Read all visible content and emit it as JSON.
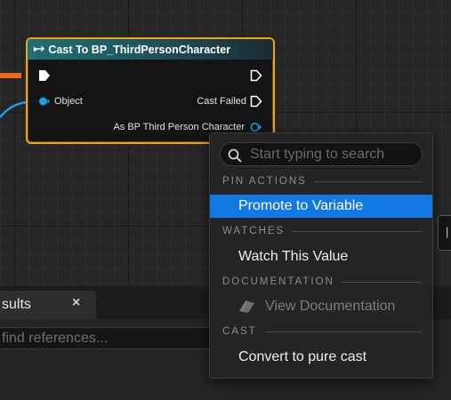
{
  "node": {
    "title": "Cast To BP_ThirdPersonCharacter",
    "header_icon": "cast-arrows-icon",
    "pins": {
      "object": "Object",
      "cast_failed": "Cast Failed",
      "as_character": "As BP Third Person Character"
    },
    "colors": {
      "border": "#f0a21f",
      "object_pin": "#1aa0e8",
      "exec_wire": "#f06a1c"
    }
  },
  "context_menu": {
    "search_placeholder": "Start typing to search",
    "sections": {
      "pin_actions": "PIN ACTIONS",
      "watches": "WATCHES",
      "documentation": "DOCUMENTATION",
      "cast": "CAST"
    },
    "items": {
      "promote": "Promote to Variable",
      "watch": "Watch This Value",
      "view_docs": "View Documentation",
      "convert": "Convert to pure cast"
    },
    "selected": "Promote to Variable",
    "highlight_color": "#1178e4"
  },
  "results_panel": {
    "tab_label": "sults",
    "close_glyph": "×",
    "find_placeholder": "find references..."
  }
}
